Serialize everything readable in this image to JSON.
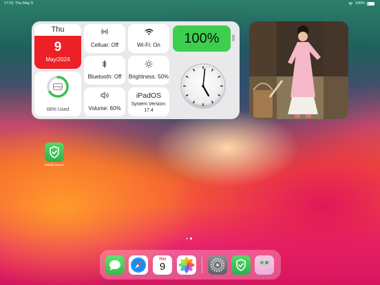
{
  "status_bar": {
    "time": "17:01",
    "date": "Thu May 9",
    "battery": "100%"
  },
  "widget": {
    "calendar": {
      "weekday": "Thu",
      "day": "9",
      "month_year": "May/2024"
    },
    "storage": {
      "label": "66% Used",
      "used_fraction": 0.66
    },
    "cellular": {
      "label": "Celluar: Off",
      "icon": "cellular-icon"
    },
    "wifi": {
      "label": "Wi-Fi: On",
      "icon": "wifi-icon"
    },
    "bluetooth": {
      "label": "Bluetooth: Off",
      "icon": "bluetooth-icon"
    },
    "brightness": {
      "label": "Brightness: 50%",
      "icon": "sun-icon"
    },
    "volume": {
      "label": "Volume: 60%",
      "icon": "speaker-icon"
    },
    "os": {
      "name": "iPadOS",
      "version": "System Version: 17.4"
    },
    "battery": {
      "label": "100%"
    },
    "clock": {
      "hour": 5,
      "minute": 1
    }
  },
  "desktop_app": {
    "name": "Mobile Doctor",
    "icon": "shield-check-icon"
  },
  "page_indicator": {
    "pages": 2,
    "current": 2
  },
  "dock": {
    "apps": [
      {
        "name": "Messages",
        "icon": "messages-icon"
      },
      {
        "name": "Safari",
        "icon": "compass-icon"
      },
      {
        "name": "Calendar",
        "weekday": "THU",
        "day": "9"
      },
      {
        "name": "Photos",
        "icon": "photos-icon"
      },
      {
        "name": "Settings",
        "icon": "gear-icon"
      },
      {
        "name": "Mobile Doctor",
        "icon": "shield-check-icon"
      },
      {
        "name": "App Library",
        "icon": "app-library-icon"
      }
    ]
  },
  "colors": {
    "battery_green": "#3ccf4e",
    "calendar_red": "#ec2026",
    "storage_ring": "#3ac04f"
  }
}
